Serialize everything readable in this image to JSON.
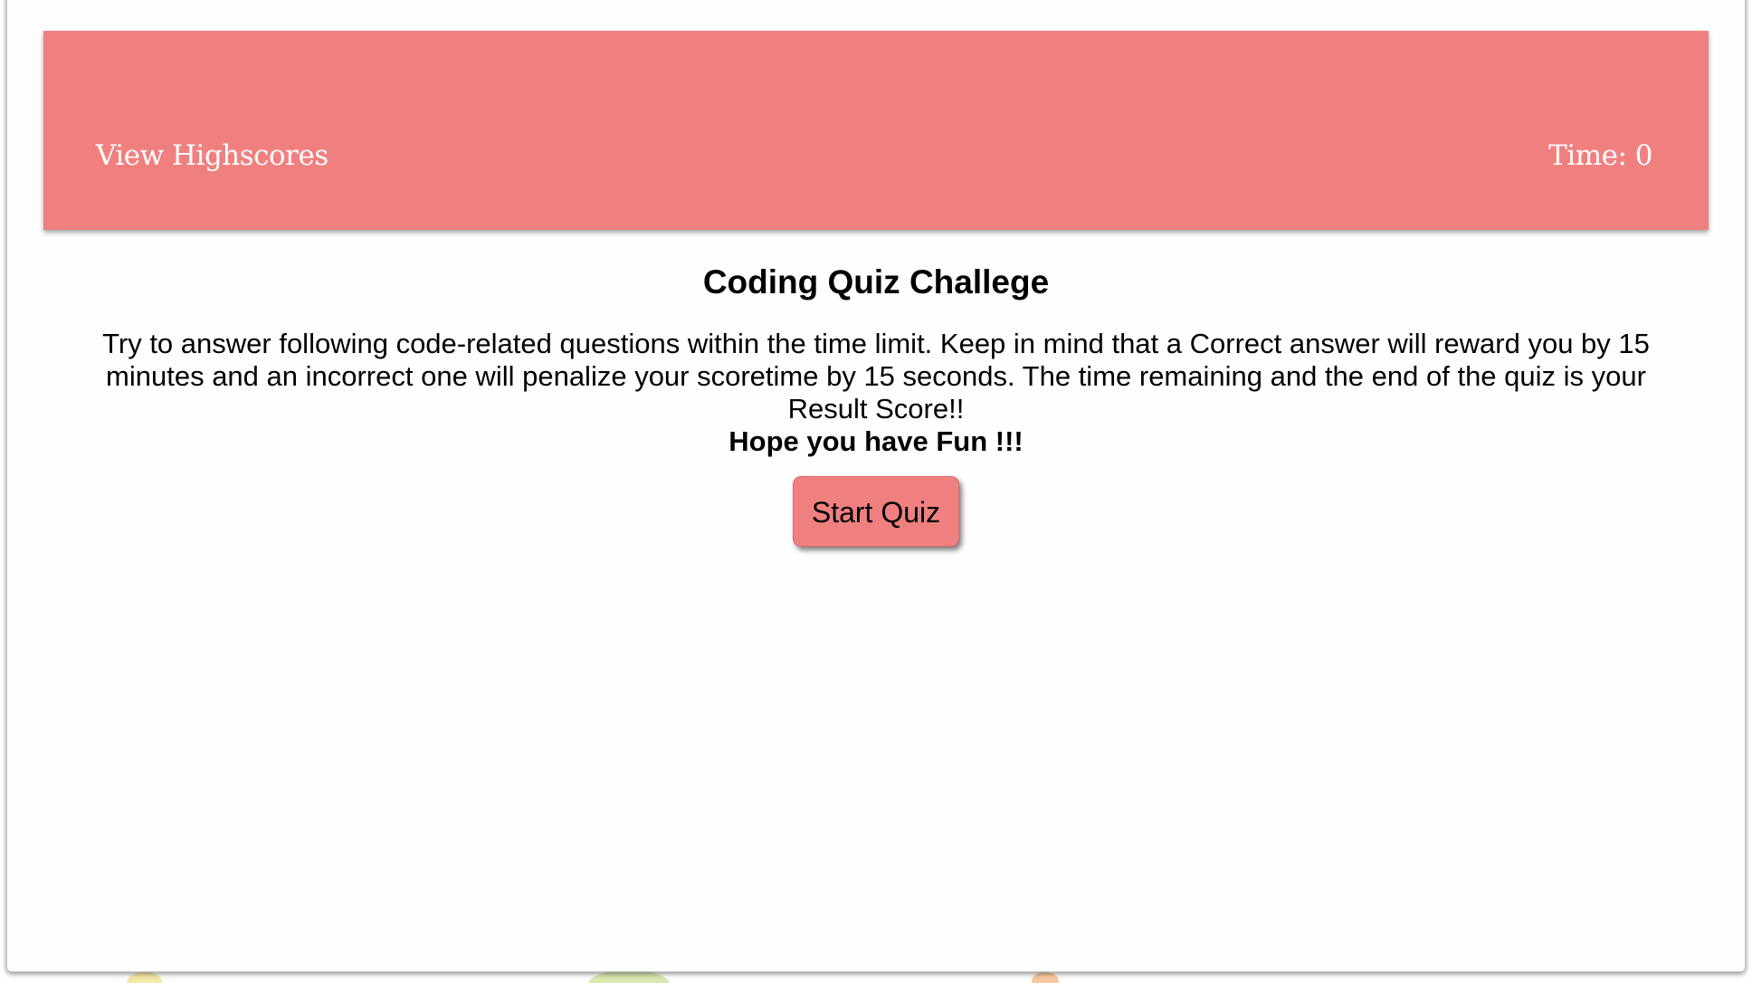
{
  "header": {
    "highscores_link": "View Highscores",
    "timer_label": "Time: 0"
  },
  "main": {
    "title": "Coding Quiz Challege",
    "description": "Try to answer following code-related questions within the time limit. Keep in mind that a Correct answer will reward you by 15 minutes and an incorrect one will penalize your scoretime by 15 seconds. The time remaining and the end of the quiz is your Result Score!!",
    "fun_text": "Hope you have Fun !!!",
    "start_button": "Start Quiz"
  },
  "colors": {
    "accent": "#f08080",
    "header_text": "#ffffff",
    "body_text": "#000000"
  }
}
